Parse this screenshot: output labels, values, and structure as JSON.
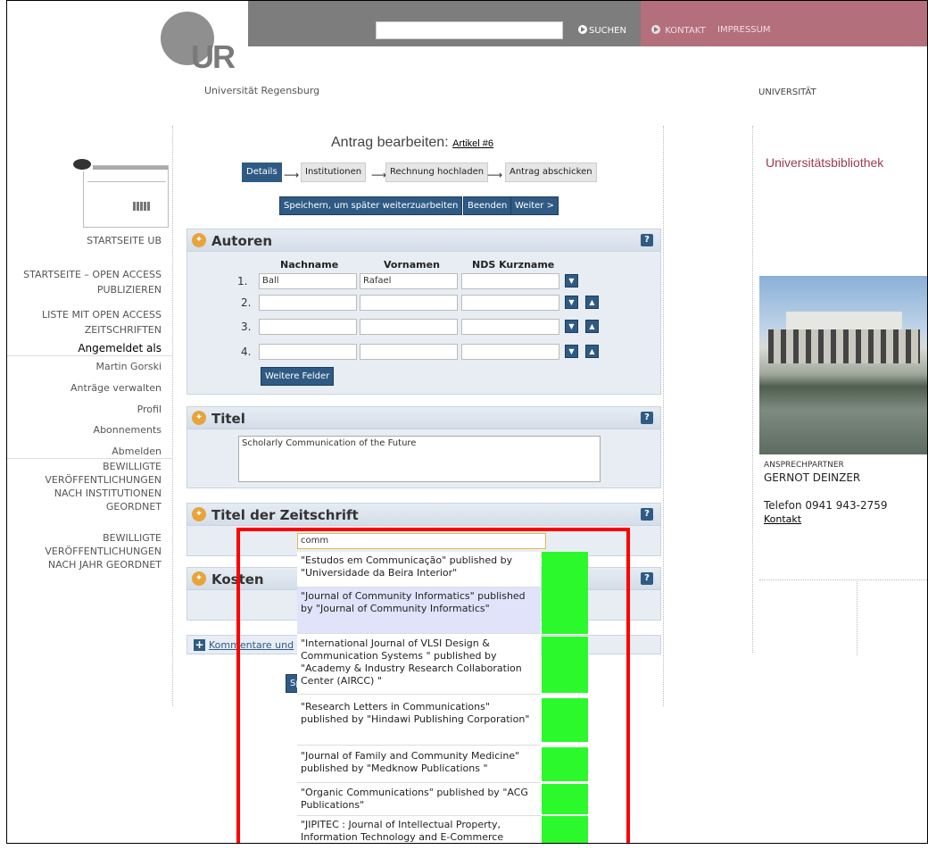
{
  "header": {
    "search_button": "SUCHEN",
    "kontakt": "KONTAKT",
    "impressum": "IMPRESSUM",
    "logo_text": "UR",
    "university": "Universität Regensburg",
    "university_right": "UNIVERSITÄT"
  },
  "sidebar": {
    "startseite_ub": "STARTSEITE UB",
    "links": [
      {
        "line1": "STARTSEITE – OPEN ACCESS",
        "line2": "PUBLIZIEREN"
      },
      {
        "line1": "LISTE MIT OPEN ACCESS",
        "line2": "ZEITSCHRIFTEN"
      }
    ],
    "logged_in_as": "Angemeldet als",
    "user": "Martin Gorski",
    "items": [
      "Anträge verwalten",
      "Profil",
      "Abonnements",
      "Abmelden"
    ],
    "approved": [
      {
        "line1": "BEWILLIGTE",
        "line2": "VERÖFFENTLICHUNGEN",
        "line3": "NACH INSTITUTIONEN",
        "line4": "GEORDNET"
      },
      {
        "line1": "BEWILLIGTE",
        "line2": "VERÖFFENTLICHUNGEN",
        "line3": "NACH JAHR GEORDNET"
      }
    ]
  },
  "main": {
    "title": "Antrag bearbeiten:",
    "title_link": "Artikel #6",
    "steps": [
      "Details",
      "Institutionen",
      "Rechnung hochladen",
      "Antrag abschicken"
    ],
    "buttons": {
      "save_later": "Speichern, um später weiterzuarbeiten",
      "end": "Beenden",
      "next": "Weiter >"
    },
    "authors": {
      "title": "Autoren",
      "col_nachname": "Nachname",
      "col_vornamen": "Vornamen",
      "col_nds": "NDS Kurzname",
      "rows": [
        {
          "num": "1.",
          "nachname": "Ball",
          "vorname": "Rafael",
          "nds": ""
        },
        {
          "num": "2.",
          "nachname": "",
          "vorname": "",
          "nds": ""
        },
        {
          "num": "3.",
          "nachname": "",
          "vorname": "",
          "nds": ""
        },
        {
          "num": "4.",
          "nachname": "",
          "vorname": "",
          "nds": ""
        }
      ],
      "more_fields": "Weitere Felder"
    },
    "titel": {
      "title": "Titel",
      "value": "Scholarly Communication of the Future"
    },
    "journal": {
      "title": "Titel der Zeitschrift",
      "value": "comm"
    },
    "kosten": {
      "title": "Kosten"
    },
    "comments_link": "Kommentare und",
    "bottom_button_fragment": "Sp",
    "help_label": "?"
  },
  "dropdown": [
    {
      "text": "\"Estudos em Communicação\" published by \"Universidade da Beira Interior\"",
      "highlighted": false
    },
    {
      "text": "\"Journal of Community Informatics\" published by \"Journal of Community Informatics\"",
      "highlighted": true
    },
    {
      "text": "\"International Journal of VLSI Design & Communication Systems \" published by \"Academy & Industry Research Collaboration Center (AIRCC) \"",
      "highlighted": false
    },
    {
      "text": "\"Research Letters in Communications\" published by \"Hindawi Publishing Corporation\"",
      "highlighted": false
    },
    {
      "text": "\"Journal of Family and Community Medicine\" published by \"Medknow Publications \"",
      "highlighted": false
    },
    {
      "text": "\"Organic Communications\" published by \"ACG Publications\"",
      "highlighted": false
    },
    {
      "text": "\"JIPITEC : Journal of Intellectual Property, Information Technology and E-Commerce",
      "highlighted": false
    }
  ],
  "right": {
    "ub_title": "Universitätsbibliothek",
    "ansprechpartner": "ANSPRECHPARTNER",
    "name": "GERNOT DEINZER",
    "telefon": "Telefon 0941 943-2759",
    "kontakt": "Kontakt"
  },
  "colors": {
    "accent": "#2f5a84",
    "brand": "#9b3b52",
    "highlight_box": "#ff0000",
    "marker": "#2cf92c"
  }
}
